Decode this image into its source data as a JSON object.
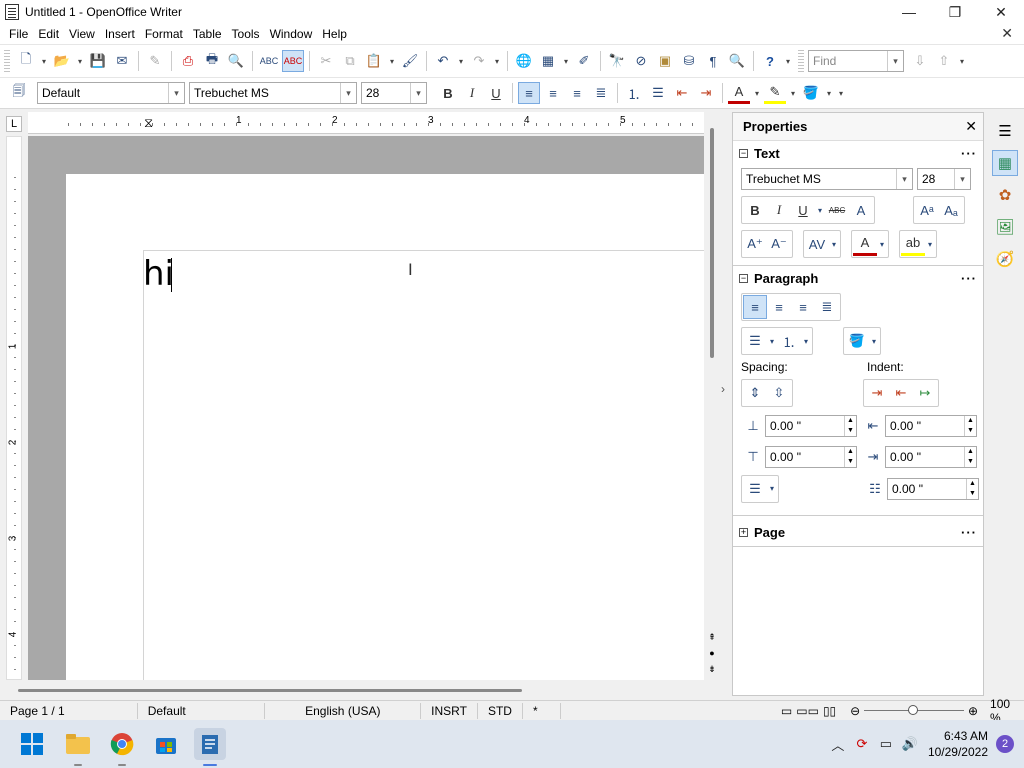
{
  "window": {
    "title": "Untitled 1 - OpenOffice Writer",
    "minimize": "—",
    "maximize": "❐",
    "close": "✕",
    "doc_close": "✕"
  },
  "menu": [
    "File",
    "Edit",
    "View",
    "Insert",
    "Format",
    "Table",
    "Tools",
    "Window",
    "Help"
  ],
  "toolbar_standard": {
    "find_placeholder": "Find",
    "icons": [
      "new-icon",
      "open-icon",
      "save-icon",
      "email-icon",
      "edit-icon",
      "pdf-icon",
      "print-icon",
      "print-preview-icon",
      "spellcheck-icon",
      "autospellcheck-icon",
      "cut-icon",
      "copy-icon",
      "paste-icon",
      "format-paintbrush-icon",
      "undo-icon",
      "redo-icon",
      "hyperlink-icon",
      "table-icon",
      "draw-icon",
      "find-replace-icon",
      "navigator-icon",
      "gallery-icon",
      "datasources-icon",
      "formatting-marks-icon",
      "zoom-icon",
      "help-icon"
    ]
  },
  "toolbar_formatting": {
    "paragraph_style": "Default",
    "font_name": "Trebuchet MS",
    "font_size": "28",
    "bold": "B",
    "italic": "I",
    "underline": "U"
  },
  "ruler": {
    "h_numbers": [
      "1",
      "2",
      "3",
      "4",
      "5"
    ],
    "v_numbers": [
      "1",
      "2",
      "3",
      "4"
    ],
    "tab_corner": "L"
  },
  "document": {
    "text": "hi"
  },
  "sidebar": {
    "title": "Properties",
    "close": "✕",
    "text_section": {
      "title": "Text",
      "font_name": "Trebuchet MS",
      "font_size": "28",
      "bold": "B",
      "italic": "I",
      "underline": "U",
      "strikethrough": "ABC"
    },
    "paragraph_section": {
      "title": "Paragraph",
      "spacing_label": "Spacing:",
      "indent_label": "Indent:",
      "above_spacing": "0.00 \"",
      "below_spacing": "0.00 \"",
      "before_indent": "0.00 \"",
      "after_indent": "0.00 \"",
      "first_line_indent": "0.00 \""
    },
    "page_section": {
      "title": "Page"
    },
    "more": "···"
  },
  "statusbar": {
    "page": "Page 1 / 1",
    "style": "Default",
    "language": "English (USA)",
    "mode": "INSRT",
    "selection": "STD",
    "modified": "*",
    "zoom": "100 %"
  },
  "taskbar": {
    "time": "6:43 AM",
    "date": "10/29/2022",
    "notifications": "2"
  },
  "colors": {
    "accent": "#0078d4",
    "font_color": "#c00000",
    "highlight": "#ffff00",
    "doc_bg": "#a8a8a8",
    "taskbar": "#dfe6ef"
  }
}
